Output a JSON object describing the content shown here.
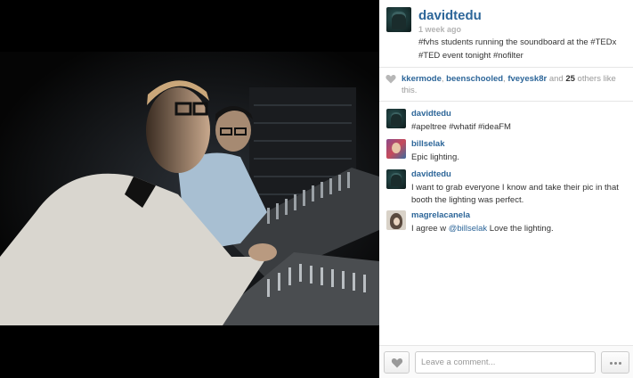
{
  "photo": {
    "alt": "Two students at a soundboard in a dark booth"
  },
  "post": {
    "author": "davidtedu",
    "time_ago": "1 week ago",
    "caption": "#fvhs students running the soundboard at the #TEDx #TED event tonight #nofilter"
  },
  "likes": {
    "users": [
      "kkermode",
      "beenschooled",
      "fveyesk8r"
    ],
    "connector": "and",
    "others_count": "25",
    "suffix": "others like this."
  },
  "comments": [
    {
      "user": "davidtedu",
      "text": "#apeltree #whatif #ideaFM",
      "avatar": "avatar-davidtedu"
    },
    {
      "user": "billselak",
      "text": "Epic lighting.",
      "avatar": "avatar-billselak"
    },
    {
      "user": "davidtedu",
      "text": "I want to grab everyone I know and take their pic in that booth the lighting was perfect.",
      "avatar": "avatar-davidtedu"
    },
    {
      "user": "magrelacanela",
      "text_prefix": "I agree w ",
      "mention": "@billselak",
      "text_suffix": " Love the lighting.",
      "avatar": "avatar-magrelacanela"
    }
  ],
  "footer": {
    "like_icon": "heart-icon",
    "comment_placeholder": "Leave a comment...",
    "more_icon": "ellipsis-icon"
  },
  "colors": {
    "link": "#2d6699",
    "text": "#333333",
    "muted": "#b3b3b3"
  }
}
